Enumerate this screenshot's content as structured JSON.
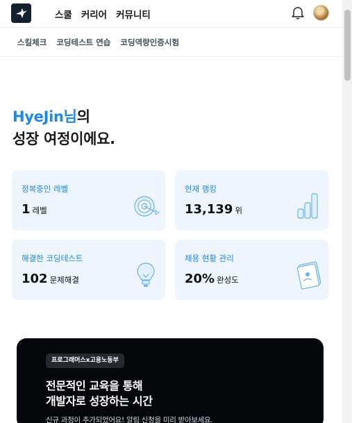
{
  "header": {
    "nav": [
      "스쿨",
      "커리어",
      "커뮤니티"
    ]
  },
  "subnav": [
    "스킬체크",
    "코딩테스트 연습",
    "코딩역량인증시험"
  ],
  "greeting": {
    "name": "HyeJin님",
    "suffix": "의",
    "line2": "성장 여정이에요."
  },
  "stats": [
    {
      "label": "정복중인 레벨",
      "value": "1",
      "unit": "레벨",
      "icon": "target-icon"
    },
    {
      "label": "현재 랭킹",
      "value": "13,139",
      "unit": "위",
      "icon": "bar-chart-icon"
    },
    {
      "label": "해결한 코딩테스트",
      "value": "102",
      "unit": "문제해결",
      "icon": "lightbulb-icon"
    },
    {
      "label": "채용 현황 관리",
      "value": "20%",
      "unit": "완성도",
      "icon": "document-icon"
    }
  ],
  "promo": {
    "badge": "프로그래머스x고용노동부",
    "title_line1": "전문적인 교육을 통해",
    "title_line2": "개발자로 성장하는 시간",
    "subtitle": "신규 과정이 추가되었어요! 알림 신청을 미리 받아보세요."
  },
  "colors": {
    "accent": "#1e88e5",
    "card_bg": "#eef5fd",
    "promo_bg": "#05070b"
  }
}
